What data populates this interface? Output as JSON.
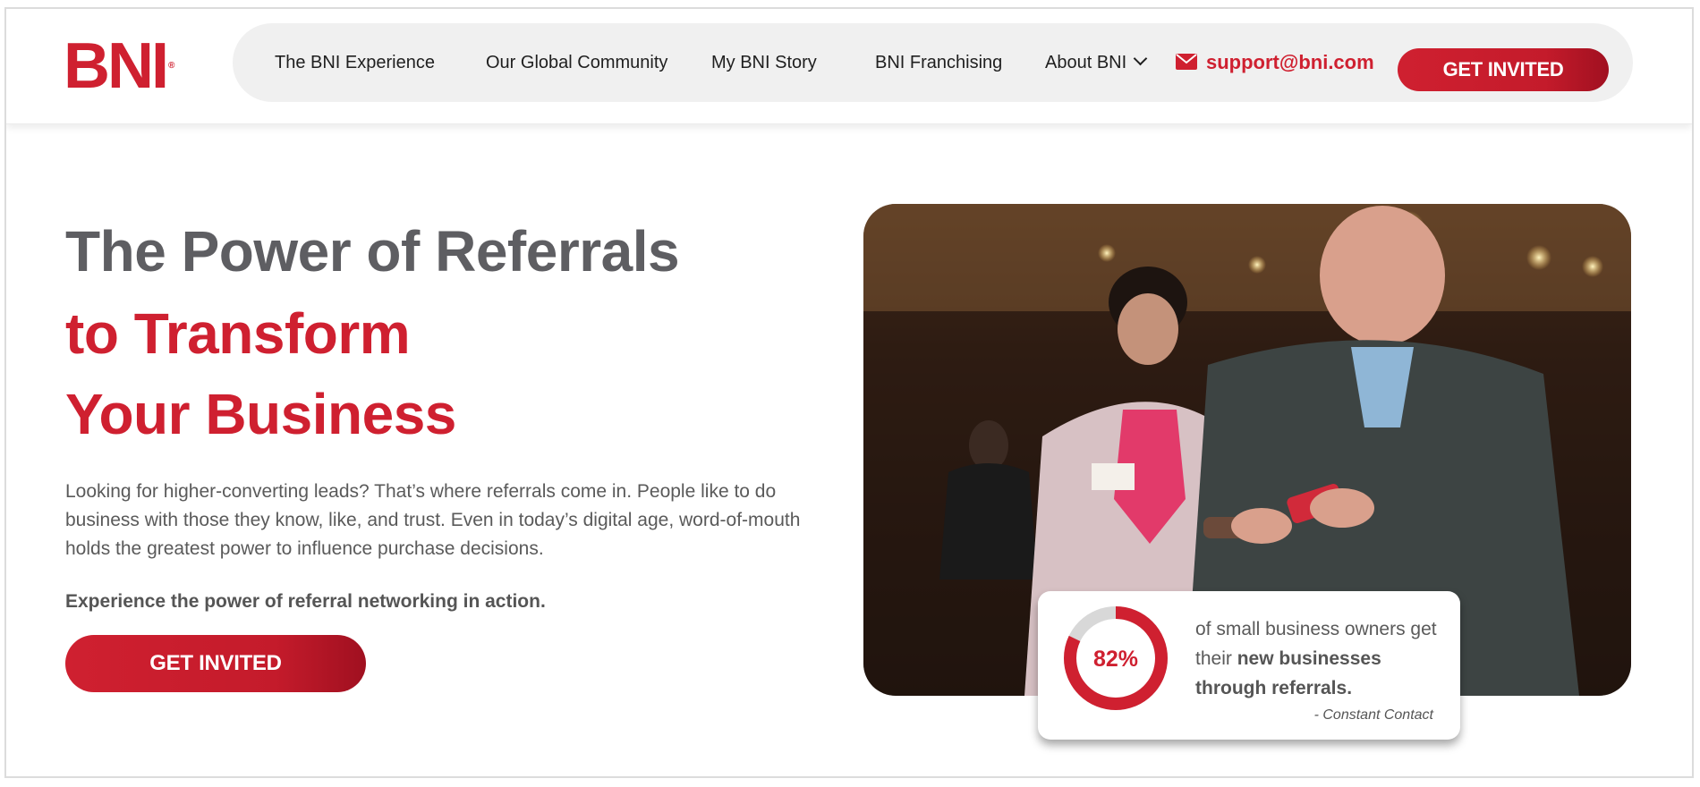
{
  "header": {
    "logo": "BNI",
    "logo_mark": "®",
    "nav": [
      {
        "label": "The BNI Experience"
      },
      {
        "label": "Our Global Community"
      },
      {
        "label": "My BNI Story"
      },
      {
        "label": "BNI Franchising"
      },
      {
        "label": "About BNI"
      }
    ],
    "email": "support@bni.com",
    "cta": "GET INVITED"
  },
  "hero": {
    "title_line1": "The Power of Referrals",
    "title_line2": "to Transform",
    "title_line3": "Your Business",
    "paragraph": "Looking for higher-converting leads? That’s where referrals come in. People like to do business with those they know, like, and trust. Even in today’s digital age, word-of-mouth holds the greatest power to influence purchase decisions.",
    "emphasis": "Experience the power of referral networking in action.",
    "cta": "GET INVITED"
  },
  "stat": {
    "percent_label": "82%",
    "percent_value": 0.82,
    "text_prefix": "of small business owners get their ",
    "text_bold": "new businesses through referrals.",
    "source": "- Constant Contact"
  },
  "colors": {
    "brand_red": "#cf2030",
    "heading_gray": "#5e5e62",
    "nav_pill": "#f0f0f0"
  },
  "icons": [
    "envelope-icon",
    "chevron-down-icon"
  ]
}
